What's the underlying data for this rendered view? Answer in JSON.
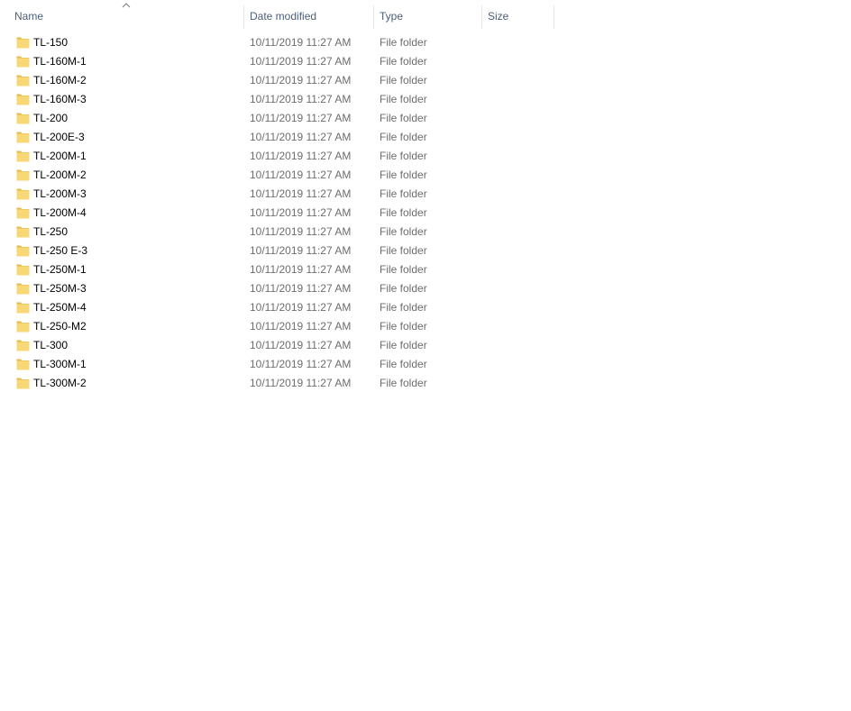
{
  "header": {
    "name_label": "Name",
    "date_label": "Date modified",
    "type_label": "Type",
    "size_label": "Size",
    "sort_indicator": "chevron-up-icon"
  },
  "colors": {
    "header_text": "#4c607a",
    "folder_fill": "#f8d775",
    "folder_tab": "#e6b84a",
    "detail_text": "#6d6d6d"
  },
  "files": [
    {
      "name": "TL-150",
      "date": "10/11/2019 11:27 AM",
      "type": "File folder",
      "size": ""
    },
    {
      "name": "TL-160M-1",
      "date": "10/11/2019 11:27 AM",
      "type": "File folder",
      "size": ""
    },
    {
      "name": "TL-160M-2",
      "date": "10/11/2019 11:27 AM",
      "type": "File folder",
      "size": ""
    },
    {
      "name": "TL-160M-3",
      "date": "10/11/2019 11:27 AM",
      "type": "File folder",
      "size": ""
    },
    {
      "name": "TL-200",
      "date": "10/11/2019 11:27 AM",
      "type": "File folder",
      "size": ""
    },
    {
      "name": "TL-200E-3",
      "date": "10/11/2019 11:27 AM",
      "type": "File folder",
      "size": ""
    },
    {
      "name": "TL-200M-1",
      "date": "10/11/2019 11:27 AM",
      "type": "File folder",
      "size": ""
    },
    {
      "name": "TL-200M-2",
      "date": "10/11/2019 11:27 AM",
      "type": "File folder",
      "size": ""
    },
    {
      "name": "TL-200M-3",
      "date": "10/11/2019 11:27 AM",
      "type": "File folder",
      "size": ""
    },
    {
      "name": "TL-200M-4",
      "date": "10/11/2019 11:27 AM",
      "type": "File folder",
      "size": ""
    },
    {
      "name": "TL-250",
      "date": "10/11/2019 11:27 AM",
      "type": "File folder",
      "size": ""
    },
    {
      "name": "TL-250 E-3",
      "date": "10/11/2019 11:27 AM",
      "type": "File folder",
      "size": ""
    },
    {
      "name": "TL-250M-1",
      "date": "10/11/2019 11:27 AM",
      "type": "File folder",
      "size": ""
    },
    {
      "name": "TL-250M-3",
      "date": "10/11/2019 11:27 AM",
      "type": "File folder",
      "size": ""
    },
    {
      "name": "TL-250M-4",
      "date": "10/11/2019 11:27 AM",
      "type": "File folder",
      "size": ""
    },
    {
      "name": "TL-250-M2",
      "date": "10/11/2019 11:27 AM",
      "type": "File folder",
      "size": ""
    },
    {
      "name": "TL-300",
      "date": "10/11/2019 11:27 AM",
      "type": "File folder",
      "size": ""
    },
    {
      "name": "TL-300M-1",
      "date": "10/11/2019 11:27 AM",
      "type": "File folder",
      "size": ""
    },
    {
      "name": "TL-300M-2",
      "date": "10/11/2019 11:27 AM",
      "type": "File folder",
      "size": ""
    }
  ]
}
